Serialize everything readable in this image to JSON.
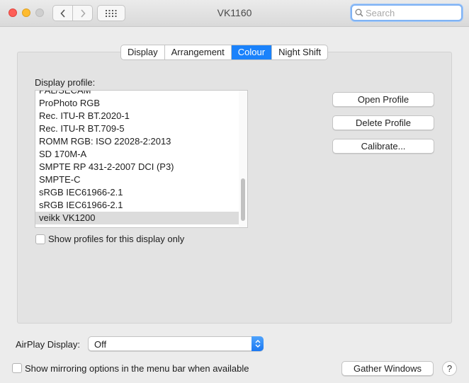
{
  "window": {
    "title": "VK1160"
  },
  "search": {
    "placeholder": "Search"
  },
  "tabs": [
    "Display",
    "Arrangement",
    "Colour",
    "Night Shift"
  ],
  "colour": {
    "profile_label": "Display profile:",
    "profiles": [
      "PAL/SECAM",
      "ProPhoto RGB",
      "Rec. ITU-R BT.2020-1",
      "Rec. ITU-R BT.709-5",
      "ROMM RGB: ISO 22028-2:2013",
      "SD 170M-A",
      "SMPTE RP 431-2-2007 DCI (P3)",
      "SMPTE-C",
      "sRGB IEC61966-2.1",
      "sRGB IEC61966-2.1",
      "veikk VK1200"
    ],
    "selected_profile": "veikk VK1200",
    "show_profiles_label": "Show profiles for this display only",
    "open_profile": "Open Profile",
    "delete_profile": "Delete Profile",
    "calibrate": "Calibrate..."
  },
  "airplay": {
    "label": "AirPlay Display:",
    "value": "Off"
  },
  "mirroring_label": "Show mirroring options in the menu bar when available",
  "gather_windows": "Gather Windows",
  "help": "?"
}
